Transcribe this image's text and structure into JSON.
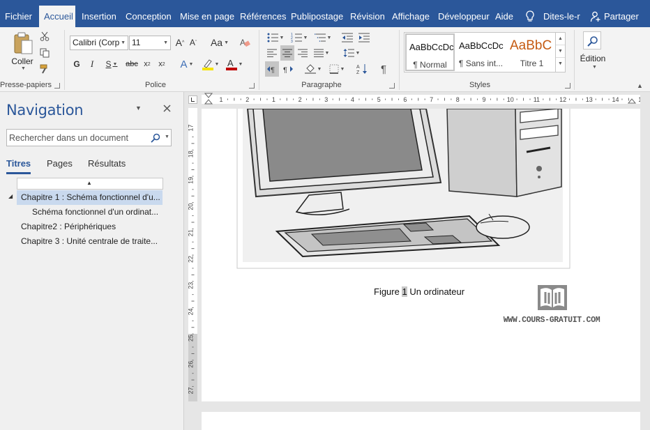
{
  "tabs": [
    {
      "label": "Fichier"
    },
    {
      "label": "Accueil"
    },
    {
      "label": "Insertion"
    },
    {
      "label": "Conception"
    },
    {
      "label": "Mise en page"
    },
    {
      "label": "Références"
    },
    {
      "label": "Publipostage"
    },
    {
      "label": "Révision"
    },
    {
      "label": "Affichage"
    },
    {
      "label": "Développeur"
    },
    {
      "label": "Aide"
    }
  ],
  "tellme": {
    "label": "Dites-le-r",
    "icon": "lightbulb-icon"
  },
  "share": {
    "label": "Partager",
    "icon": "person-add-icon"
  },
  "ribbon": {
    "clipboard": {
      "label": "Presse-papiers",
      "paste_label": "Coller"
    },
    "font": {
      "label": "Police",
      "font_name": "Calibri (Corp",
      "font_size": "11"
    },
    "paragraph": {
      "label": "Paragraphe"
    },
    "styles": {
      "label": "Styles",
      "items": [
        {
          "preview": "AaBbCcDc",
          "name": "¶ Normal"
        },
        {
          "preview": "AaBbCcDc",
          "name": "¶ Sans int..."
        },
        {
          "preview": "AaBbC",
          "name": "Titre 1"
        }
      ]
    },
    "editing": {
      "label": "Édition"
    }
  },
  "navigation": {
    "title": "Navigation",
    "search_placeholder": "Rechercher dans un document",
    "tabs": [
      {
        "label": "Titres"
      },
      {
        "label": "Pages"
      },
      {
        "label": "Résultats"
      }
    ],
    "headings": [
      {
        "label": "Chapitre 1 : Schéma fonctionnel d'u..."
      },
      {
        "label": "Schéma fonctionnel d'un ordinat..."
      },
      {
        "label": "Chapitre2 : Périphériques"
      },
      {
        "label": "Chapitre 3 : Unité centrale de traite..."
      }
    ]
  },
  "document": {
    "caption_prefix": "Figure ",
    "caption_number": "1",
    "caption_text": " Un ordinateur",
    "watermark": "WWW.COURS-GRATUIT.COM",
    "hruler_labels": [
      "1",
      "2",
      "1",
      "2",
      "3",
      "4",
      "5",
      "6",
      "7",
      "8",
      "9",
      "10",
      "11",
      "12",
      "13",
      "14",
      "15"
    ],
    "vruler_labels": [
      "17",
      "18",
      "19",
      "20",
      "21",
      "22",
      "23",
      "24",
      "25",
      "26",
      "27"
    ]
  },
  "colors": {
    "accent": "#2b579a",
    "ribbon_bg": "#f3f3f3",
    "selection": "#c9d9ee"
  }
}
